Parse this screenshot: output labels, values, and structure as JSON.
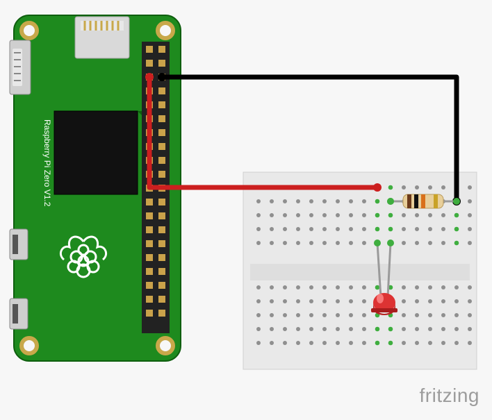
{
  "diagram": {
    "board_label": "Raspberry Pi Zero V1.2",
    "credit": "fritzing",
    "components": {
      "board": "Raspberry Pi Zero",
      "led": "Red LED",
      "resistor": "Resistor",
      "breadboard": "Half-size breadboard"
    },
    "wires": [
      {
        "name": "GPIO to LED (via breadboard rail)",
        "color": "#cc1f1f"
      },
      {
        "name": "LED cathode → resistor → GND",
        "color": "#000000"
      }
    ],
    "resistor_bands": [
      "brown",
      "black",
      "orange",
      "gold"
    ]
  }
}
